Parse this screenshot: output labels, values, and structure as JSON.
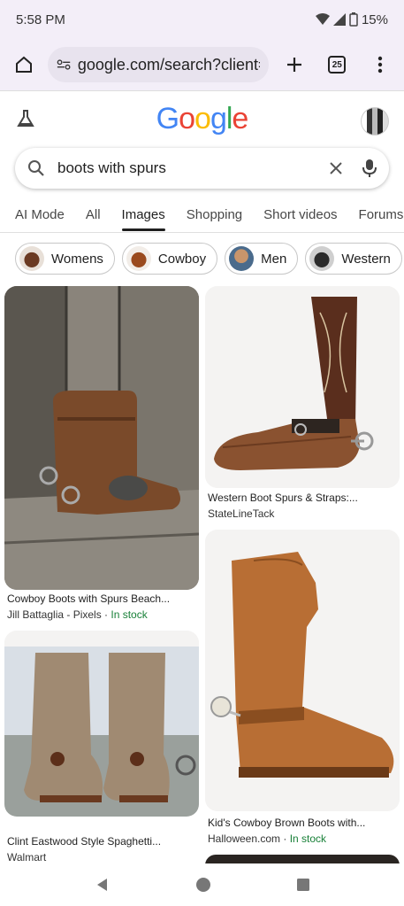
{
  "status": {
    "time": "5:58 PM",
    "battery": "15%"
  },
  "browser": {
    "url": "google.com/search?client=m",
    "tab_count": "25"
  },
  "search": {
    "query": "boots with spurs"
  },
  "nav_tabs": [
    "AI Mode",
    "All",
    "Images",
    "Shopping",
    "Short videos",
    "Forums"
  ],
  "chips": [
    "Womens",
    "Cowboy",
    "Men",
    "Western"
  ],
  "results": [
    {
      "caption": "Cowboy Boots with Spurs Beach...",
      "source": "Jill Battaglia - Pixels · ",
      "stock": "In stock"
    },
    {
      "caption": "Western Boot Spurs & Straps:...",
      "source": "StateLineTack",
      "stock": ""
    },
    {
      "caption": "Clint Eastwood Style Spaghetti...",
      "source": "Walmart",
      "stock": ""
    },
    {
      "caption": "Kid's Cowboy Brown Boots with...",
      "source": "Halloween.com · ",
      "stock": "In stock"
    }
  ],
  "colors": {
    "google_blue": "#4285F4",
    "google_red": "#EA4335",
    "google_yellow": "#FBBC05",
    "google_green": "#34A853",
    "in_stock": "#188038"
  }
}
